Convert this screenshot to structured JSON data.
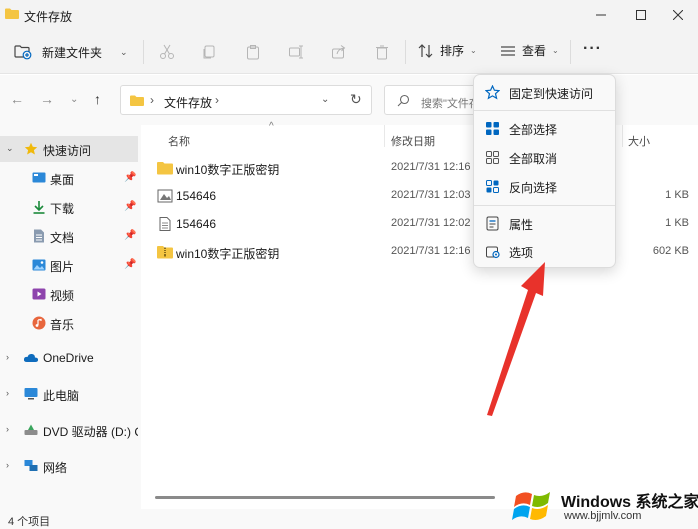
{
  "window": {
    "title": "文件存放"
  },
  "toolbar": {
    "new_folder_label": "新建文件夹",
    "sort_label": "排序",
    "view_label": "查看",
    "more_label": "···"
  },
  "address": {
    "crumb": "文件存放",
    "separator": "›"
  },
  "search": {
    "placeholder": "搜索\"文件存"
  },
  "sidebar": {
    "items": [
      {
        "label": "快速访问",
        "icon": "star-icon",
        "expander": "⌄",
        "selected": true
      },
      {
        "label": "桌面",
        "icon": "desktop-icon",
        "pinned": true
      },
      {
        "label": "下载",
        "icon": "download-icon",
        "pinned": true
      },
      {
        "label": "文档",
        "icon": "document-icon",
        "pinned": true
      },
      {
        "label": "图片",
        "icon": "picture-icon",
        "pinned": true
      },
      {
        "label": "视频",
        "icon": "video-icon"
      },
      {
        "label": "音乐",
        "icon": "music-icon"
      },
      {
        "label": "OneDrive",
        "icon": "cloud-icon",
        "expander": "›"
      },
      {
        "label": "此电脑",
        "icon": "computer-icon",
        "expander": "›"
      },
      {
        "label": "DVD 驱动器 (D:) CF",
        "icon": "dvd-icon",
        "expander": "›"
      },
      {
        "label": "网络",
        "icon": "network-icon",
        "expander": "›"
      }
    ]
  },
  "columns": {
    "name": "名称",
    "date": "修改日期",
    "size": "大小"
  },
  "files": [
    {
      "name": "win10数字正版密钥",
      "date": "2021/7/31 12:16",
      "size": "",
      "icon": "folder-icon"
    },
    {
      "name": "154646",
      "date": "2021/7/31 12:03",
      "size": "1 KB",
      "icon": "image-file-icon"
    },
    {
      "name": "154646",
      "date": "2021/7/31 12:02",
      "size": "1 KB",
      "icon": "text-file-icon"
    },
    {
      "name": "win10数字正版密钥",
      "date": "2021/7/31 12:16",
      "size": "602 KB",
      "icon": "zip-folder-icon"
    }
  ],
  "menu": {
    "items": [
      {
        "label": "固定到快速访问",
        "icon": "pin-star-icon"
      },
      {
        "label": "全部选择",
        "icon": "select-all-icon"
      },
      {
        "label": "全部取消",
        "icon": "select-none-icon"
      },
      {
        "label": "反向选择",
        "icon": "invert-selection-icon"
      },
      {
        "label": "属性",
        "icon": "properties-icon"
      },
      {
        "label": "选项",
        "icon": "options-icon"
      }
    ]
  },
  "status": {
    "count": "4 个项目"
  },
  "watermark": {
    "brand": "Windows 系统之家",
    "url": "www.bjjmlv.com"
  },
  "colors": {
    "accent": "#0067c0",
    "arrow": "#e8322b",
    "folder": "#f4c542"
  }
}
